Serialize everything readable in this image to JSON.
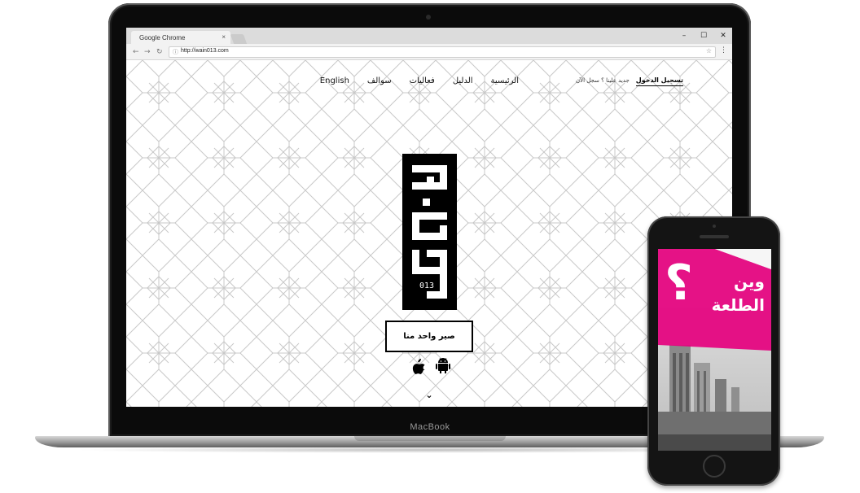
{
  "browser": {
    "tab_title": "Google Chrome",
    "tab_close": "×",
    "url": "http://wain013.com",
    "window_controls": [
      "–",
      "☐",
      "✕"
    ]
  },
  "site": {
    "nav_items": [
      "English",
      "سوالف",
      "فعاليات",
      "الدليل",
      "الرئيسية"
    ],
    "register_prompt": "جديد علينا ؟ سجل الآن",
    "login_label": "تسجيل الدخول",
    "logo_code": "013",
    "cta_label": "صير واحد منا",
    "store_icons": [
      "apple-icon",
      "android-icon"
    ],
    "scroll_icon": "⌄"
  },
  "device": {
    "laptop_brand": "MacBook"
  },
  "phone": {
    "headline_line1": "وين",
    "headline_line2": "الطلعة",
    "question_mark": "؟"
  },
  "colors": {
    "accent_pink": "#e5007e",
    "logo_black": "#000000",
    "pattern_gray": "#c8c8c8"
  }
}
